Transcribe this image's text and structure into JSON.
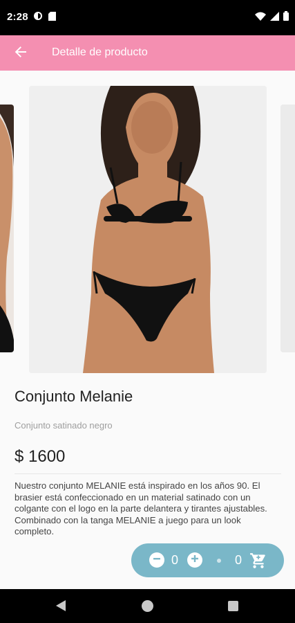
{
  "status_bar": {
    "time": "2:28"
  },
  "app_bar": {
    "title": "Detalle de producto"
  },
  "product": {
    "name": "Conjunto Melanie",
    "subtitle": "Conjunto satinado negro",
    "price": "$ 1600",
    "description": "Nuestro conjunto MELANIE está inspirado en los años 90. El brasier está confeccionado en un material satinado con un colgante con el logo en la parte delantera y tirantes ajustables. Combinado con la tanga MELANIE a juego para un look completo."
  },
  "cart_control": {
    "quantity": "0",
    "cart_count": "0"
  },
  "colors": {
    "app_bar": "#f48fb1",
    "cart_pill": "#7ab7c8"
  }
}
